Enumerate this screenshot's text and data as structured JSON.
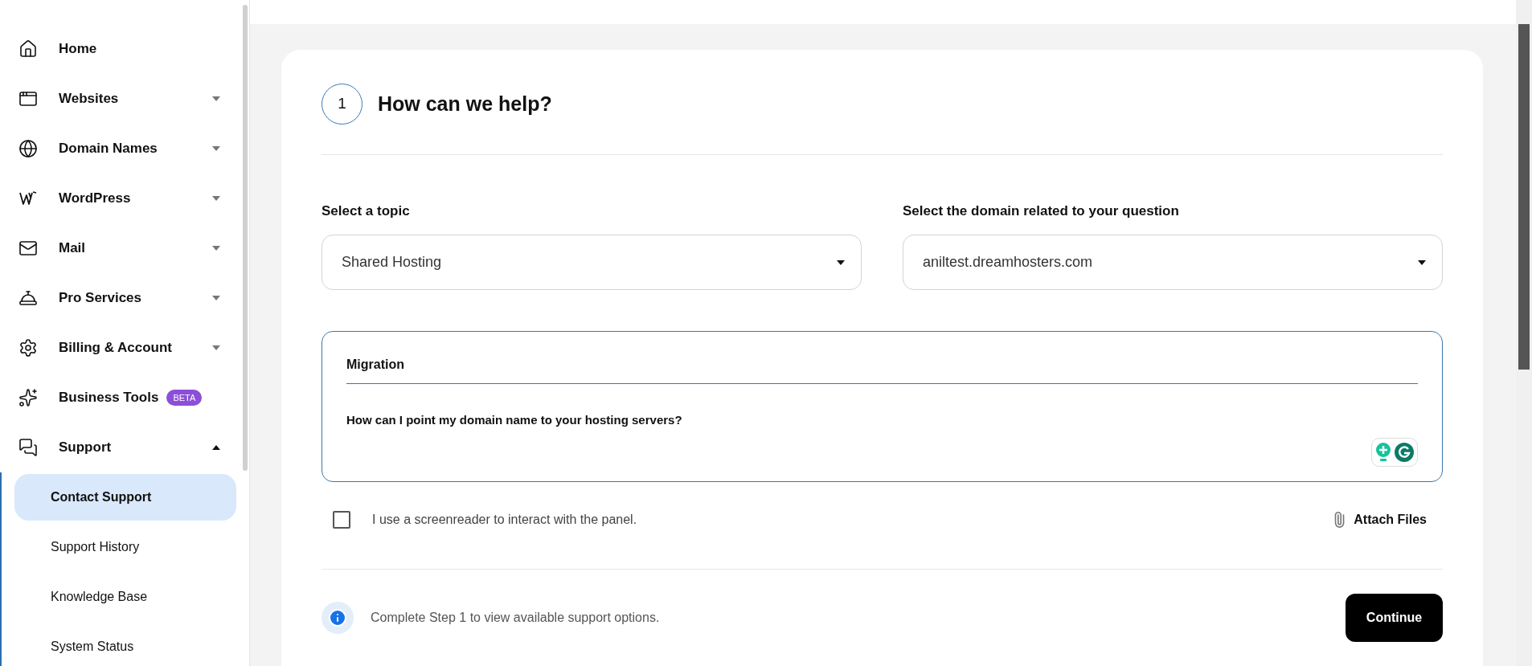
{
  "sidebar": {
    "items": [
      {
        "kind": "link",
        "label": "Home"
      },
      {
        "kind": "menu",
        "label": "Websites",
        "expanded": false
      },
      {
        "kind": "menu",
        "label": "Domain Names",
        "expanded": false
      },
      {
        "kind": "menu",
        "label": "WordPress",
        "expanded": false
      },
      {
        "kind": "menu",
        "label": "Mail",
        "expanded": false
      },
      {
        "kind": "menu",
        "label": "Pro Services",
        "expanded": false
      },
      {
        "kind": "menu",
        "label": "Billing & Account",
        "expanded": false
      },
      {
        "kind": "link",
        "label": "Business Tools",
        "badge": "BETA"
      },
      {
        "kind": "menu",
        "label": "Support",
        "expanded": true,
        "children": [
          {
            "label": "Contact Support",
            "selected": true
          },
          {
            "label": "Support History",
            "selected": false
          },
          {
            "label": "Knowledge Base",
            "selected": false
          },
          {
            "label": "System Status",
            "selected": false
          }
        ]
      }
    ]
  },
  "step": {
    "number": "1",
    "title": "How can we help?"
  },
  "topic": {
    "label": "Select a topic",
    "value": "Shared Hosting"
  },
  "domain": {
    "label": "Select the domain related to your question",
    "value": "aniltest.dreamhosters.com"
  },
  "message": {
    "subject": "Migration",
    "body": "How can I point my domain name to your hosting servers?"
  },
  "screenreader": {
    "label": "I use a screenreader to interact with the panel.",
    "checked": false
  },
  "attach": {
    "label": "Attach Files"
  },
  "notice": {
    "text": "Complete Step 1 to view available support options."
  },
  "continue_button": {
    "label": "Continue"
  }
}
